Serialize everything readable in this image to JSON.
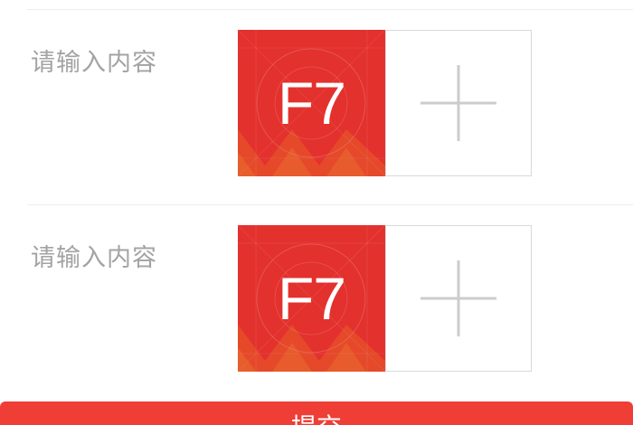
{
  "form": {
    "rows": [
      {
        "label": "请输入内容",
        "thumbnail_text": "F7"
      },
      {
        "label": "请输入内容",
        "thumbnail_text": "F7"
      }
    ],
    "add_icon": "plus-icon",
    "submit_label": "提交"
  },
  "colors": {
    "accent": "#ef3e36",
    "thumbnail": "#e3312e",
    "label": "#a3a3a3",
    "add_border": "#d9d9d9",
    "plus": "#cccccc"
  }
}
